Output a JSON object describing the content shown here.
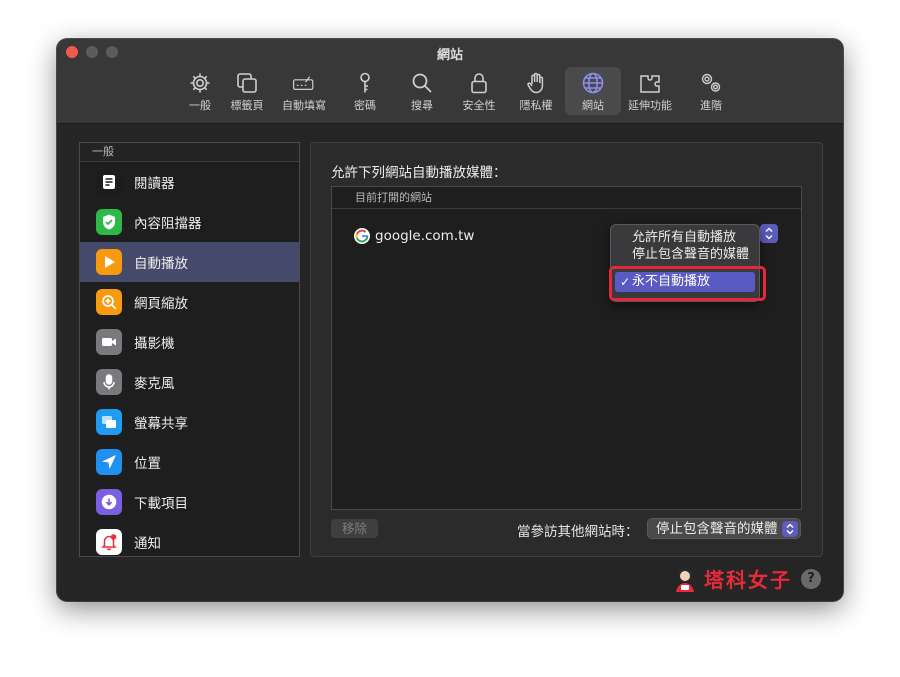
{
  "window": {
    "title": "網站"
  },
  "toolbar": {
    "items": [
      {
        "label": "一般",
        "icon": "gear-icon"
      },
      {
        "label": "標籤頁",
        "icon": "tabs-icon"
      },
      {
        "label": "自動填寫",
        "icon": "autofill-icon"
      },
      {
        "label": "密碼",
        "icon": "key-icon"
      },
      {
        "label": "搜尋",
        "icon": "search-icon"
      },
      {
        "label": "安全性",
        "icon": "lock-icon"
      },
      {
        "label": "隱私權",
        "icon": "hand-icon"
      },
      {
        "label": "網站",
        "icon": "globe-icon",
        "active": true
      },
      {
        "label": "延伸功能",
        "icon": "puzzle-icon"
      },
      {
        "label": "進階",
        "icon": "gears-icon"
      }
    ]
  },
  "sidebar": {
    "header": "一般",
    "items": [
      {
        "label": "閱讀器",
        "icon": "reader-icon",
        "color": "#1c1c1e"
      },
      {
        "label": "內容阻擋器",
        "icon": "shield-check-icon",
        "color": "#2fb84a"
      },
      {
        "label": "自動播放",
        "icon": "play-icon",
        "color": "#f79a0e",
        "selected": true
      },
      {
        "label": "網頁縮放",
        "icon": "zoom-icon",
        "color": "#f79a0e"
      },
      {
        "label": "攝影機",
        "icon": "camera-icon",
        "color": "#7a7a7e"
      },
      {
        "label": "麥克風",
        "icon": "microphone-icon",
        "color": "#7a7a7e"
      },
      {
        "label": "螢幕共享",
        "icon": "screen-share-icon",
        "color": "#1f9cf0"
      },
      {
        "label": "位置",
        "icon": "location-icon",
        "color": "#1f8ff0"
      },
      {
        "label": "下載項目",
        "icon": "download-icon",
        "color": "#7a5fe0"
      },
      {
        "label": "通知",
        "icon": "bell-icon",
        "color": "#e8303c"
      }
    ]
  },
  "content": {
    "title": "允許下列網站自動播放媒體：",
    "table_header": "目前打開的網站",
    "site": "google.com.tw",
    "menu": {
      "options": [
        "允許所有自動播放",
        "停止包含聲音的媒體",
        "永不自動播放"
      ],
      "selected": "永不自動播放",
      "check": "✓"
    },
    "remove_label": "移除",
    "visit_label": "當參訪其他網站時：",
    "visit_value": "停止包含聲音的媒體"
  },
  "brand": {
    "text": "塔科女子"
  },
  "help": {
    "label": "?"
  },
  "colors": {
    "accent": "#5c5cbd",
    "highlight": "#e8263a",
    "selected_row": "#464a6a"
  }
}
